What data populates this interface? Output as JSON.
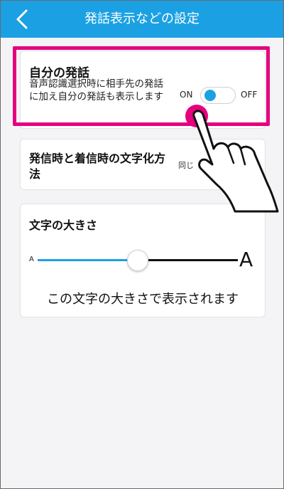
{
  "header": {
    "title": "発話表示などの設定"
  },
  "own_speech": {
    "title": "自分の発話",
    "description": "音声認識選択時に相手先の発話に加え自分の発話も表示します",
    "on_label": "ON",
    "off_label": "OFF",
    "toggle_state": "ON"
  },
  "text_mode": {
    "title": "発信時と着信時の文字化方法",
    "value": "同じ"
  },
  "text_size": {
    "title": "文字の大きさ",
    "small_label": "A",
    "large_label": "A",
    "slider_level": 0.5,
    "preview": "この文字の大きさで表示されます"
  },
  "colors": {
    "accent": "#1ba1e3",
    "highlight": "#e6007e",
    "background": "#f4f4f6"
  },
  "icons": [
    "back-chevron-icon",
    "pointing-hand-icon"
  ]
}
